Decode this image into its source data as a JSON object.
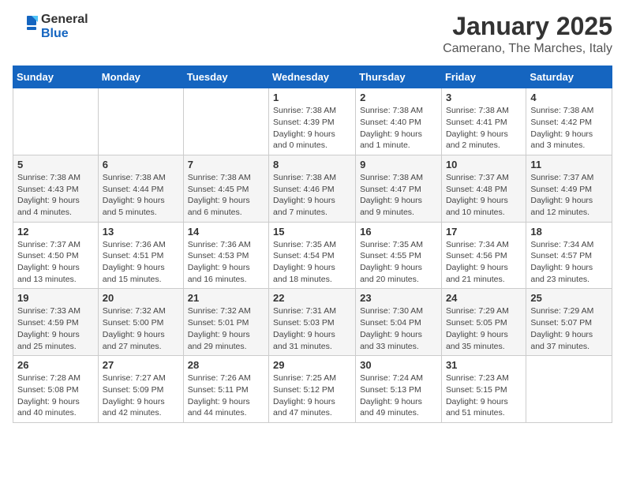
{
  "header": {
    "logo_general": "General",
    "logo_blue": "Blue",
    "title": "January 2025",
    "subtitle": "Camerano, The Marches, Italy"
  },
  "calendar": {
    "days_of_week": [
      "Sunday",
      "Monday",
      "Tuesday",
      "Wednesday",
      "Thursday",
      "Friday",
      "Saturday"
    ],
    "weeks": [
      [
        {
          "day": "",
          "detail": ""
        },
        {
          "day": "",
          "detail": ""
        },
        {
          "day": "",
          "detail": ""
        },
        {
          "day": "1",
          "detail": "Sunrise: 7:38 AM\nSunset: 4:39 PM\nDaylight: 9 hours\nand 0 minutes."
        },
        {
          "day": "2",
          "detail": "Sunrise: 7:38 AM\nSunset: 4:40 PM\nDaylight: 9 hours\nand 1 minute."
        },
        {
          "day": "3",
          "detail": "Sunrise: 7:38 AM\nSunset: 4:41 PM\nDaylight: 9 hours\nand 2 minutes."
        },
        {
          "day": "4",
          "detail": "Sunrise: 7:38 AM\nSunset: 4:42 PM\nDaylight: 9 hours\nand 3 minutes."
        }
      ],
      [
        {
          "day": "5",
          "detail": "Sunrise: 7:38 AM\nSunset: 4:43 PM\nDaylight: 9 hours\nand 4 minutes."
        },
        {
          "day": "6",
          "detail": "Sunrise: 7:38 AM\nSunset: 4:44 PM\nDaylight: 9 hours\nand 5 minutes."
        },
        {
          "day": "7",
          "detail": "Sunrise: 7:38 AM\nSunset: 4:45 PM\nDaylight: 9 hours\nand 6 minutes."
        },
        {
          "day": "8",
          "detail": "Sunrise: 7:38 AM\nSunset: 4:46 PM\nDaylight: 9 hours\nand 7 minutes."
        },
        {
          "day": "9",
          "detail": "Sunrise: 7:38 AM\nSunset: 4:47 PM\nDaylight: 9 hours\nand 9 minutes."
        },
        {
          "day": "10",
          "detail": "Sunrise: 7:37 AM\nSunset: 4:48 PM\nDaylight: 9 hours\nand 10 minutes."
        },
        {
          "day": "11",
          "detail": "Sunrise: 7:37 AM\nSunset: 4:49 PM\nDaylight: 9 hours\nand 12 minutes."
        }
      ],
      [
        {
          "day": "12",
          "detail": "Sunrise: 7:37 AM\nSunset: 4:50 PM\nDaylight: 9 hours\nand 13 minutes."
        },
        {
          "day": "13",
          "detail": "Sunrise: 7:36 AM\nSunset: 4:51 PM\nDaylight: 9 hours\nand 15 minutes."
        },
        {
          "day": "14",
          "detail": "Sunrise: 7:36 AM\nSunset: 4:53 PM\nDaylight: 9 hours\nand 16 minutes."
        },
        {
          "day": "15",
          "detail": "Sunrise: 7:35 AM\nSunset: 4:54 PM\nDaylight: 9 hours\nand 18 minutes."
        },
        {
          "day": "16",
          "detail": "Sunrise: 7:35 AM\nSunset: 4:55 PM\nDaylight: 9 hours\nand 20 minutes."
        },
        {
          "day": "17",
          "detail": "Sunrise: 7:34 AM\nSunset: 4:56 PM\nDaylight: 9 hours\nand 21 minutes."
        },
        {
          "day": "18",
          "detail": "Sunrise: 7:34 AM\nSunset: 4:57 PM\nDaylight: 9 hours\nand 23 minutes."
        }
      ],
      [
        {
          "day": "19",
          "detail": "Sunrise: 7:33 AM\nSunset: 4:59 PM\nDaylight: 9 hours\nand 25 minutes."
        },
        {
          "day": "20",
          "detail": "Sunrise: 7:32 AM\nSunset: 5:00 PM\nDaylight: 9 hours\nand 27 minutes."
        },
        {
          "day": "21",
          "detail": "Sunrise: 7:32 AM\nSunset: 5:01 PM\nDaylight: 9 hours\nand 29 minutes."
        },
        {
          "day": "22",
          "detail": "Sunrise: 7:31 AM\nSunset: 5:03 PM\nDaylight: 9 hours\nand 31 minutes."
        },
        {
          "day": "23",
          "detail": "Sunrise: 7:30 AM\nSunset: 5:04 PM\nDaylight: 9 hours\nand 33 minutes."
        },
        {
          "day": "24",
          "detail": "Sunrise: 7:29 AM\nSunset: 5:05 PM\nDaylight: 9 hours\nand 35 minutes."
        },
        {
          "day": "25",
          "detail": "Sunrise: 7:29 AM\nSunset: 5:07 PM\nDaylight: 9 hours\nand 37 minutes."
        }
      ],
      [
        {
          "day": "26",
          "detail": "Sunrise: 7:28 AM\nSunset: 5:08 PM\nDaylight: 9 hours\nand 40 minutes."
        },
        {
          "day": "27",
          "detail": "Sunrise: 7:27 AM\nSunset: 5:09 PM\nDaylight: 9 hours\nand 42 minutes."
        },
        {
          "day": "28",
          "detail": "Sunrise: 7:26 AM\nSunset: 5:11 PM\nDaylight: 9 hours\nand 44 minutes."
        },
        {
          "day": "29",
          "detail": "Sunrise: 7:25 AM\nSunset: 5:12 PM\nDaylight: 9 hours\nand 47 minutes."
        },
        {
          "day": "30",
          "detail": "Sunrise: 7:24 AM\nSunset: 5:13 PM\nDaylight: 9 hours\nand 49 minutes."
        },
        {
          "day": "31",
          "detail": "Sunrise: 7:23 AM\nSunset: 5:15 PM\nDaylight: 9 hours\nand 51 minutes."
        },
        {
          "day": "",
          "detail": ""
        }
      ]
    ]
  }
}
